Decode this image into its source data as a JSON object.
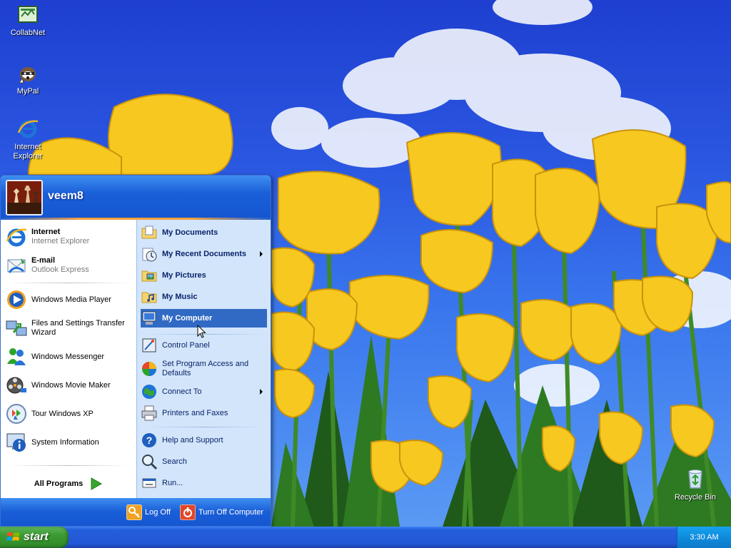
{
  "desktop": {
    "icons": [
      {
        "label": "CollabNet",
        "icon": "collabnet-icon"
      },
      {
        "label": "MyPal",
        "icon": "mypal-icon"
      },
      {
        "label": "Internet Explorer",
        "icon": "ie-icon"
      },
      {
        "label": "Recycle Bin",
        "icon": "recycle-bin-icon"
      }
    ]
  },
  "start_menu": {
    "user_name": "veem8",
    "pinned": [
      {
        "title": "Internet",
        "subtitle": "Internet Explorer",
        "icon": "ie-icon"
      },
      {
        "title": "E-mail",
        "subtitle": "Outlook Express",
        "icon": "outlook-express-icon"
      }
    ],
    "recent_programs": [
      {
        "label": "Windows Media Player",
        "icon": "media-player-icon"
      },
      {
        "label": "Files and Settings Transfer Wizard",
        "icon": "transfer-wizard-icon"
      },
      {
        "label": "Windows Messenger",
        "icon": "messenger-icon"
      },
      {
        "label": "Windows Movie Maker",
        "icon": "movie-maker-icon"
      },
      {
        "label": "Tour Windows XP",
        "icon": "tour-xp-icon"
      },
      {
        "label": "System Information",
        "icon": "system-info-icon"
      }
    ],
    "all_programs": "All Programs",
    "places": [
      {
        "label": "My Documents",
        "icon": "folder-documents-icon"
      },
      {
        "label": "My Recent Documents",
        "icon": "recent-documents-icon"
      },
      {
        "label": "My Pictures",
        "icon": "folder-pictures-icon"
      },
      {
        "label": "My Music",
        "icon": "folder-music-icon"
      },
      {
        "label": "My Computer",
        "icon": "my-computer-icon"
      }
    ],
    "settings": [
      {
        "label": "Control Panel",
        "icon": "control-panel-icon"
      },
      {
        "label": "Set Program Access and Defaults",
        "icon": "program-access-icon"
      },
      {
        "label": "Connect To",
        "icon": "connect-to-icon"
      },
      {
        "label": "Printers and Faxes",
        "icon": "printer-icon"
      }
    ],
    "help": [
      {
        "label": "Help and Support",
        "icon": "help-icon"
      },
      {
        "label": "Search",
        "icon": "search-icon"
      },
      {
        "label": "Run...",
        "icon": "run-icon"
      }
    ],
    "log_off": "Log Off",
    "turn_off": "Turn Off Computer"
  },
  "taskbar": {
    "start_label": "start",
    "clock": "3:30 AM"
  },
  "colors": {
    "menu_blue": "#1a5fd8",
    "highlight": "#316ac5",
    "right_pane": "#d3e5fa",
    "start_green": "#3a9a33",
    "tulip_yellow": "#f7c81f"
  }
}
